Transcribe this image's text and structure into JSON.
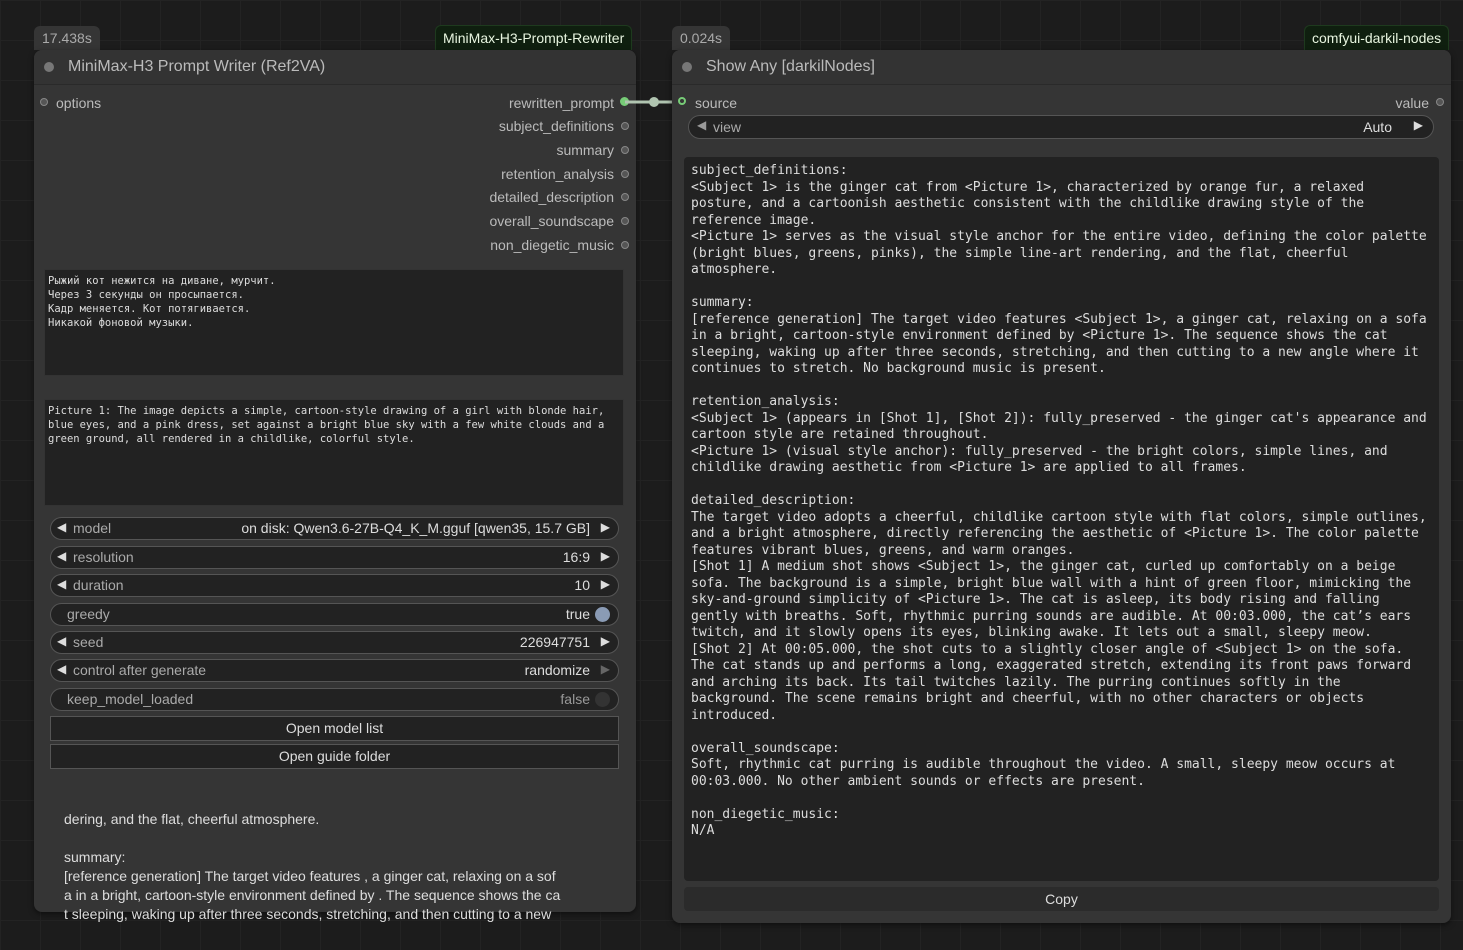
{
  "writer_node": {
    "exec_time": "17.438s",
    "source": "MiniMax-H3-Prompt-Rewriter",
    "title": "MiniMax-H3 Prompt Writer (Ref2VA)",
    "input_label": "options",
    "outputs": [
      "rewritten_prompt",
      "subject_definitions",
      "summary",
      "retention_analysis",
      "detailed_description",
      "overall_soundscape",
      "non_diegetic_music"
    ],
    "prompt_text": "Рыжий кот нежится на диване, мурчит.\nЧерез 3 секунды он просыпается.\nКадр меняется. Кот потягивается.\nНикакой фоновой музыки.",
    "picture_text": "Picture 1: The image depicts a simple, cartoon-style drawing of a girl with blonde hair, blue eyes, and a pink dress, set against a bright blue sky with a few white clouds and a green ground, all rendered in a childlike, colorful style.",
    "widgets": {
      "model_label": "model",
      "model_value": "on disk: Qwen3.6-27B-Q4_K_M.gguf [qwen35, 15.7 GB]",
      "resolution_label": "resolution",
      "resolution_value": "16:9",
      "duration_label": "duration",
      "duration_value": "10",
      "greedy_label": "greedy",
      "greedy_value": "true",
      "seed_label": "seed",
      "seed_value": "226947751",
      "cag_label": "control after generate",
      "cag_value": "randomize",
      "kml_label": "keep_model_loaded",
      "kml_value": "false"
    },
    "open_model_list": "Open model list",
    "open_guide_folder": "Open guide folder",
    "preview_text": "dering, and the flat, cheerful atmosphere.\n\nsummary:\n[reference generation] The target video features , a ginger cat, relaxing on a sof\na in a bright, cartoon-style environment defined by . The sequence shows the ca\nt sleeping, waking up after three seconds, stretching, and then cutting to a new"
  },
  "show_node": {
    "exec_time": "0.024s",
    "source": "comfyui-darkil-nodes",
    "title": "Show Any [darkilNodes]",
    "input_label": "source",
    "output_label": "value",
    "view_label": "view",
    "view_value": "Auto",
    "output_text": "subject_definitions:\n<Subject 1> is the ginger cat from <Picture 1>, characterized by orange fur, a relaxed\nposture, and a cartoonish aesthetic consistent with the childlike drawing style of the\nreference image.\n<Picture 1> serves as the visual style anchor for the entire video, defining the color palette\n(bright blues, greens, pinks), the simple line-art rendering, and the flat, cheerful\natmosphere.\n\nsummary:\n[reference generation] The target video features <Subject 1>, a ginger cat, relaxing on a sofa\nin a bright, cartoon-style environment defined by <Picture 1>. The sequence shows the cat\nsleeping, waking up after three seconds, stretching, and then cutting to a new angle where it\ncontinues to stretch. No background music is present.\n\nretention_analysis:\n<Subject 1> (appears in [Shot 1], [Shot 2]): fully_preserved - the ginger cat's appearance and\ncartoon style are retained throughout.\n<Picture 1> (visual style anchor): fully_preserved - the bright colors, simple lines, and\nchildlike drawing aesthetic from <Picture 1> are applied to all frames.\n\ndetailed_description:\nThe target video adopts a cheerful, childlike cartoon style with flat colors, simple outlines,\nand a bright atmosphere, directly referencing the aesthetic of <Picture 1>. The color palette\nfeatures vibrant blues, greens, and warm oranges.\n[Shot 1] A medium shot shows <Subject 1>, the ginger cat, curled up comfortably on a beige\nsofa. The background is a simple, bright blue wall with a hint of green floor, mimicking the\nsky-and-ground simplicity of <Picture 1>. The cat is asleep, its body rising and falling\ngently with breaths. Soft, rhythmic purring sounds are audible. At 00:03.000, the cat’s ears\ntwitch, and it slowly opens its eyes, blinking awake. It lets out a small, sleepy meow.\n[Shot 2] At 00:05.000, the shot cuts to a slightly closer angle of <Subject 1> on the sofa.\nThe cat stands up and performs a long, exaggerated stretch, extending its front paws forward\nand arching its back. Its tail twitches lazily. The purring continues softly in the\nbackground. The scene remains bright and cheerful, with no other characters or objects\nintroduced.\n\noverall_soundscape:\nSoft, rhythmic cat purring is audible throughout the video. A small, sleepy meow occurs at\n00:03.000. No other ambient sounds or effects are present.\n\nnon_diegetic_music:\nN/A",
    "copy_label": "Copy"
  },
  "colors": {
    "canvas": "#1c1c1c",
    "node_body": "#353535",
    "link": "#b0c4b0",
    "slot_active": "#77cc77",
    "source_badge_bg": "#0f1f0f"
  }
}
